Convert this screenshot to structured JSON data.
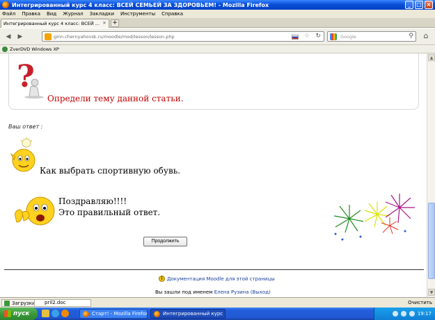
{
  "window": {
    "title": "Интегрированный курс 4 класс: ВСЕЙ СЕМЬЕЙ ЗА ЗДОРОВЬЕМ! - Mozilla Firefox",
    "minimize": "_",
    "maximize": "□",
    "close": "×"
  },
  "menu": [
    "Файл",
    "Правка",
    "Вид",
    "Журнал",
    "Закладки",
    "Инструменты",
    "Справка"
  ],
  "tab": {
    "label": "Интегрированный курс 4 класс: ВСЕЙ ...",
    "close": "×",
    "new_tab": "+"
  },
  "nav": {
    "back": "◀",
    "forward": "▶",
    "url": "ginn.chernyahovsk.ru/moodle/mod/lesson/lesson.php",
    "search_placeholder": "Google",
    "home": "⌂"
  },
  "bookmarks": [
    "ZverDVD Windows XP"
  ],
  "content": {
    "question": "Определи тему данной статьи.",
    "your_answer_label": "Ваш ответ :",
    "answer": "Как выбрать спортивную обувь.",
    "congrats_line1": "Поздравляю!!!!",
    "congrats_line2": "Это правильный ответ.",
    "continue_button": "Продолжить",
    "docs_link": "Документация Moodle для этой страницы",
    "login_prefix": "Вы зашли под именем",
    "user_name": "Елена Рузина",
    "logout": "(Выход)"
  },
  "downloads": {
    "label": "Загрузки",
    "file": "pril2.doc",
    "clear": "Очистить"
  },
  "taskbar": {
    "start": "пуск",
    "tasks": [
      "Старт! - Mozilla Firefox",
      "Интегрированный курс ..."
    ],
    "clock": "19:17"
  },
  "colors": {
    "question_red": "#c00000",
    "link_blue": "#1a3e9b",
    "taskbar_blue": "#245edb",
    "start_green": "#3a9a3a"
  }
}
